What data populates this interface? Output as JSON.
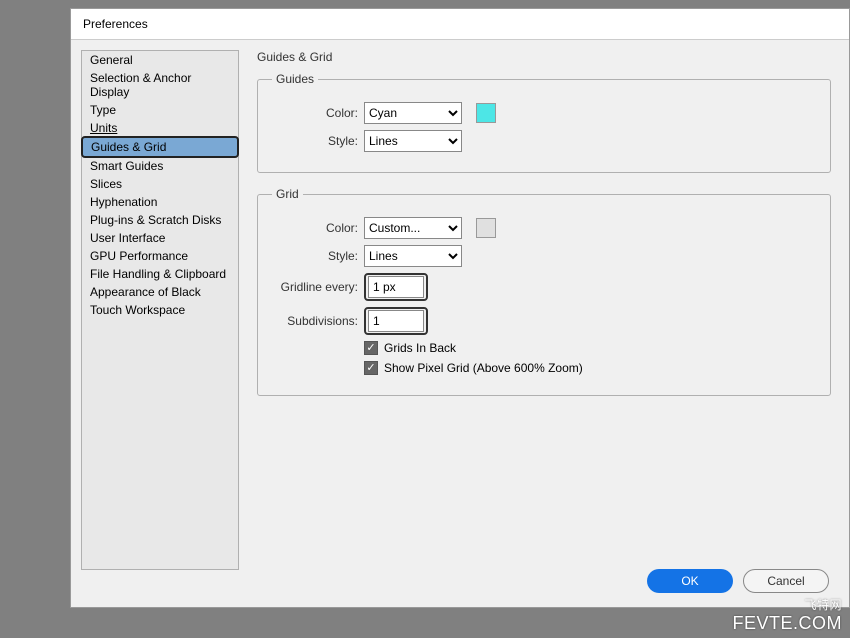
{
  "dialog": {
    "title": "Preferences",
    "ok": "OK",
    "cancel": "Cancel"
  },
  "sidebar": {
    "items": [
      {
        "label": "General"
      },
      {
        "label": "Selection & Anchor Display"
      },
      {
        "label": "Type"
      },
      {
        "label": "Units",
        "underline": true
      },
      {
        "label": "Guides & Grid",
        "selected": true
      },
      {
        "label": "Smart Guides"
      },
      {
        "label": "Slices"
      },
      {
        "label": "Hyphenation"
      },
      {
        "label": "Plug-ins & Scratch Disks"
      },
      {
        "label": "User Interface"
      },
      {
        "label": "GPU Performance"
      },
      {
        "label": "File Handling & Clipboard"
      },
      {
        "label": "Appearance of Black"
      },
      {
        "label": "Touch Workspace"
      }
    ]
  },
  "content": {
    "heading": "Guides & Grid",
    "guides": {
      "legend": "Guides",
      "color_label": "Color:",
      "color_value": "Cyan",
      "style_label": "Style:",
      "style_value": "Lines"
    },
    "grid": {
      "legend": "Grid",
      "color_label": "Color:",
      "color_value": "Custom...",
      "style_label": "Style:",
      "style_value": "Lines",
      "gridline_label": "Gridline every:",
      "gridline_value": "1 px",
      "subdivisions_label": "Subdivisions:",
      "subdivisions_value": "1",
      "grids_in_back": "Grids In Back",
      "show_pixel_grid": "Show Pixel Grid (Above 600% Zoom)"
    }
  },
  "watermark": {
    "cn": "飞特网",
    "en": "FEVTE.COM"
  }
}
